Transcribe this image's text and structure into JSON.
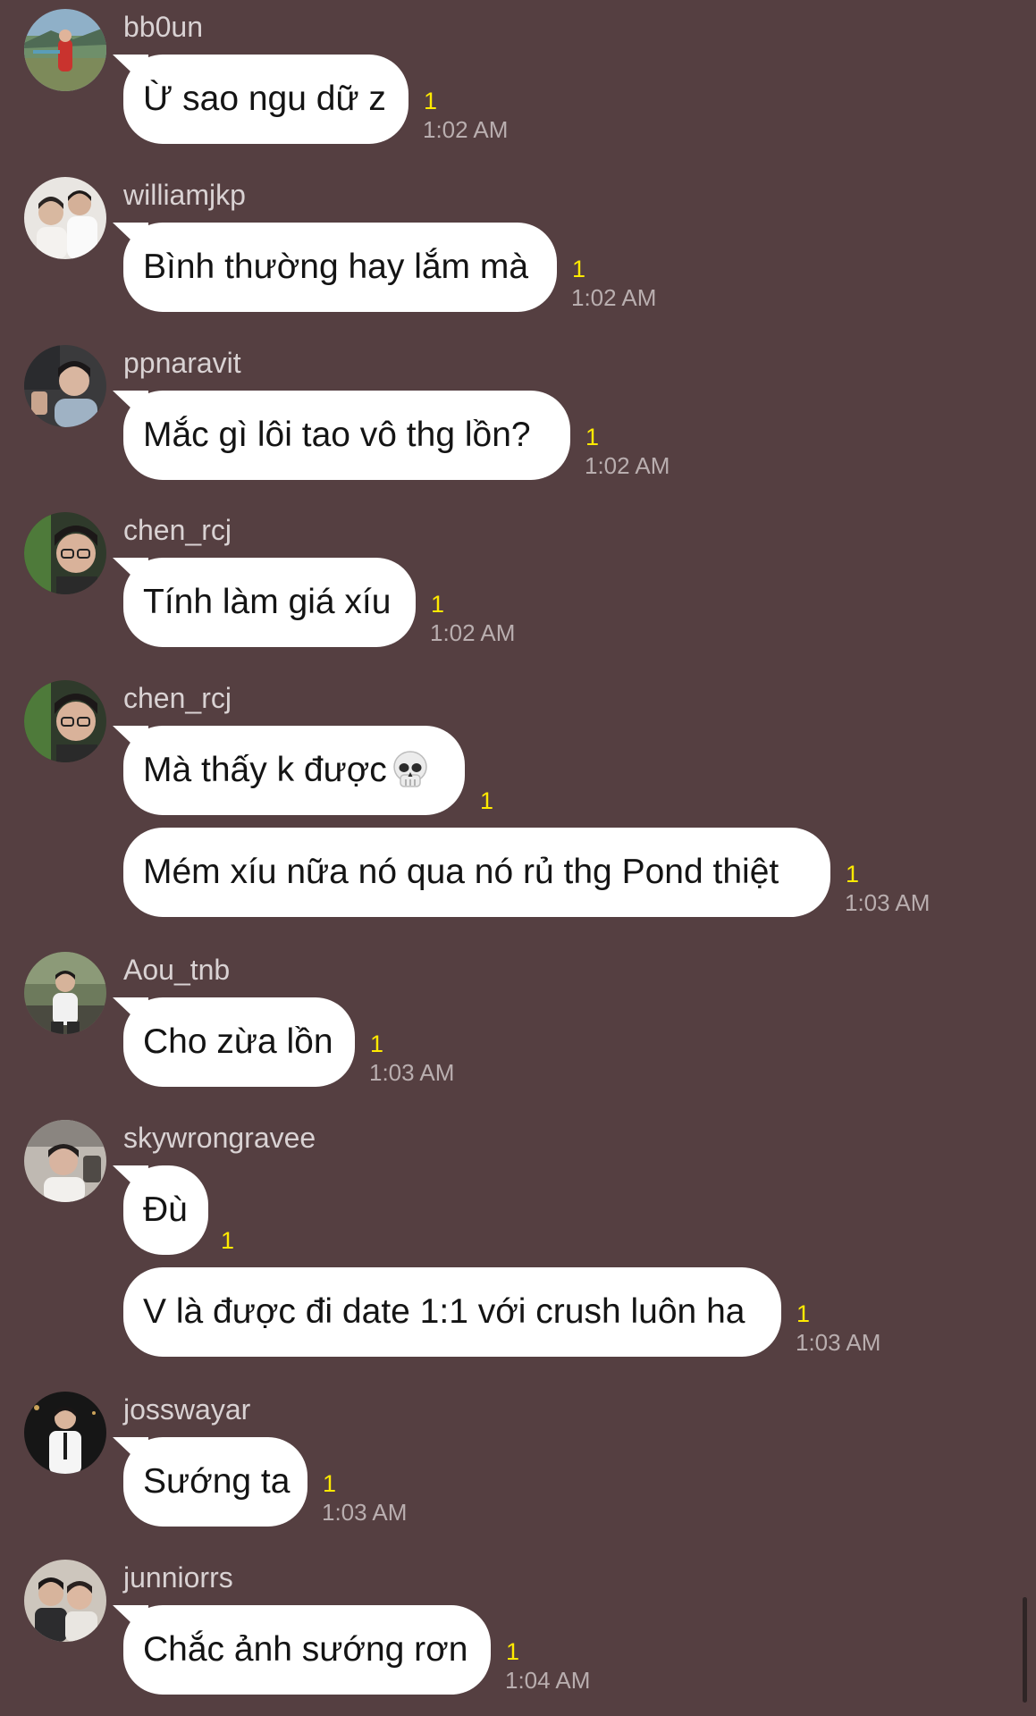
{
  "colors": {
    "background": "#553f41",
    "bubble": "#ffffff",
    "unread": "#ffea00",
    "timestamp": "#b9aeaf",
    "username": "#d9d2d3"
  },
  "messages": [
    {
      "username": "bb0un",
      "avatar": "avatar-landscape-photo",
      "items": [
        {
          "text": "Ừ sao ngu dữ z",
          "unread": "1",
          "time": "1:02 AM"
        }
      ]
    },
    {
      "username": "williamjkp",
      "avatar": "avatar-two-people-photo",
      "items": [
        {
          "text": "Bình thường hay lắm mà",
          "unread": "1",
          "time": "1:02 AM"
        }
      ]
    },
    {
      "username": "ppnaravit",
      "avatar": "avatar-car-selfie-photo",
      "items": [
        {
          "text": "Mắc gì lôi tao vô thg lồn?",
          "unread": "1",
          "time": "1:02 AM"
        }
      ]
    },
    {
      "username": "chen_rcj",
      "avatar": "avatar-glasses-selfie-photo",
      "items": [
        {
          "text": "Tính làm giá xíu",
          "unread": "1",
          "time": "1:02 AM"
        }
      ]
    },
    {
      "username": "chen_rcj",
      "avatar": "avatar-glasses-selfie-photo",
      "items": [
        {
          "text": "Mà thấy k được",
          "emoji": "skull-emoji",
          "unread": "1"
        },
        {
          "text": "Mém xíu nữa nó qua nó rủ thg Pond thiệt",
          "unread": "1",
          "time": "1:03 AM"
        }
      ]
    },
    {
      "username": "Aou_tnb",
      "avatar": "avatar-outdoor-photo",
      "items": [
        {
          "text": "Cho zừa lồn",
          "unread": "1",
          "time": "1:03 AM"
        }
      ]
    },
    {
      "username": "skywrongravee",
      "avatar": "avatar-car-portrait-photo",
      "items": [
        {
          "text": "Đù",
          "unread": "1"
        },
        {
          "text": "V là được đi date 1:1 với crush luôn ha",
          "unread": "1",
          "time": "1:03 AM"
        }
      ]
    },
    {
      "username": "josswayar",
      "avatar": "avatar-night-portrait-photo",
      "items": [
        {
          "text": "Sướng ta",
          "unread": "1",
          "time": "1:03 AM"
        }
      ]
    },
    {
      "username": "junniorrs",
      "avatar": "avatar-two-people-selfie-photo",
      "items": [
        {
          "text": "Chắc ảnh sướng rơn",
          "unread": "1",
          "time": "1:04 AM"
        }
      ]
    }
  ]
}
